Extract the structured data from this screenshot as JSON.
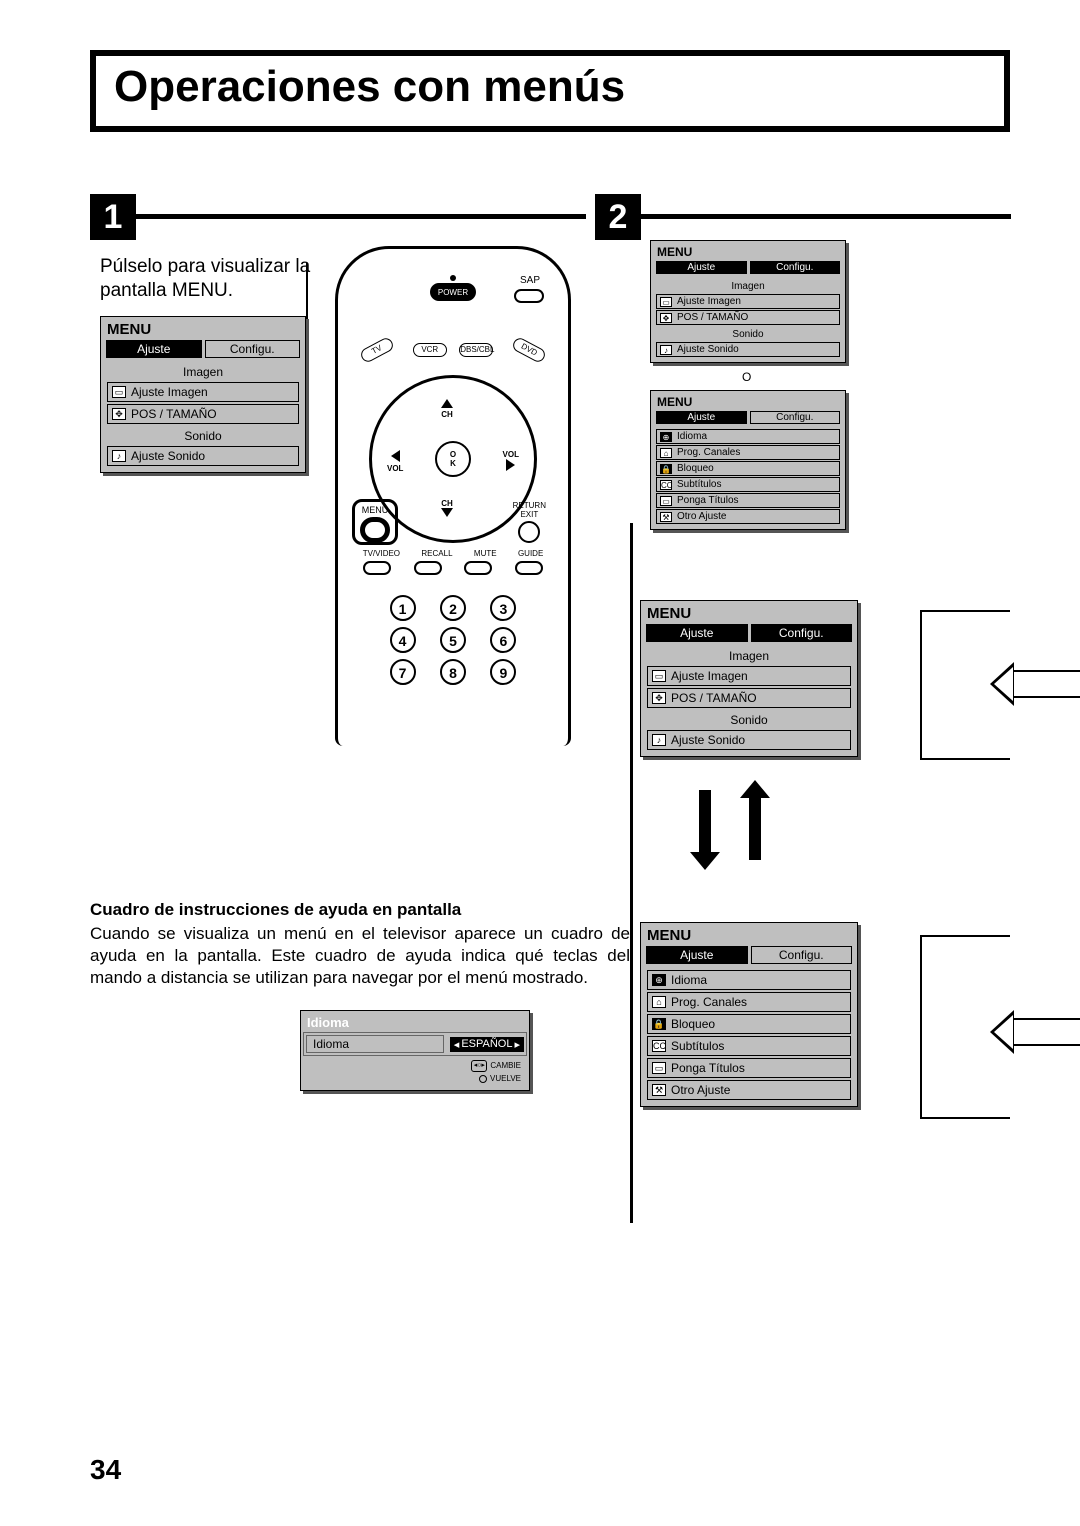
{
  "page": {
    "title": "Operaciones con menús",
    "number": "34"
  },
  "step1": {
    "badge": "1",
    "text": "Púlselo para visualizar la pantalla MENU."
  },
  "step2": {
    "badge": "2"
  },
  "menuAjuste": {
    "title": "MENU",
    "tabAjuste": "Ajuste",
    "tabConfigu": "Configu.",
    "sectionImagen": "Imagen",
    "itemAjusteImagen": "Ajuste Imagen",
    "itemPosTamano": "POS / TAMAÑO",
    "sectionSonido": "Sonido",
    "itemAjusteSonido": "Ajuste Sonido"
  },
  "menuConfigu": {
    "title": "MENU",
    "tabAjuste": "Ajuste",
    "tabConfigu": "Configu.",
    "itemIdioma": "Idioma",
    "itemProgCanales": "Prog. Canales",
    "itemBloqueo": "Bloqueo",
    "itemSubtitulos": "Subtítulos",
    "itemPongaTitulos": "Ponga Títulos",
    "itemOtroAjuste": "Otro Ajuste"
  },
  "remote": {
    "power": "POWER",
    "sap": "SAP",
    "tv": "TV",
    "vcr": "VCR",
    "dbs": "DBS/CBL",
    "dvd": "DVD",
    "ch": "CH",
    "ok_o": "O",
    "ok_k": "K",
    "vol": "VOL",
    "menu": "MENU",
    "return": "RETURN",
    "exit": "EXIT",
    "tvvideo": "TV/VIDEO",
    "recall": "RECALL",
    "mute": "MUTE",
    "guide": "GUIDE",
    "n1": "1",
    "n2": "2",
    "n3": "3",
    "n4": "4",
    "n5": "5",
    "n6": "6",
    "n7": "7",
    "n8": "8",
    "n9": "9"
  },
  "help": {
    "heading": "Cuadro de instrucciones de ayuda en pantalla",
    "body": "Cuando se visualiza un menú en el televisor aparece un cuadro de ayuda en la pantalla. Este cuadro de ayuda indica qué teclas del mando a distancia se utilizan para navegar por el menú mostrado."
  },
  "idiomaPanel": {
    "title": "Idioma",
    "label": "Idioma",
    "value": "ESPAÑOL",
    "hintCambie": "CAMBIE",
    "hintVuelve": "VUELVE"
  },
  "marker_o": "O"
}
